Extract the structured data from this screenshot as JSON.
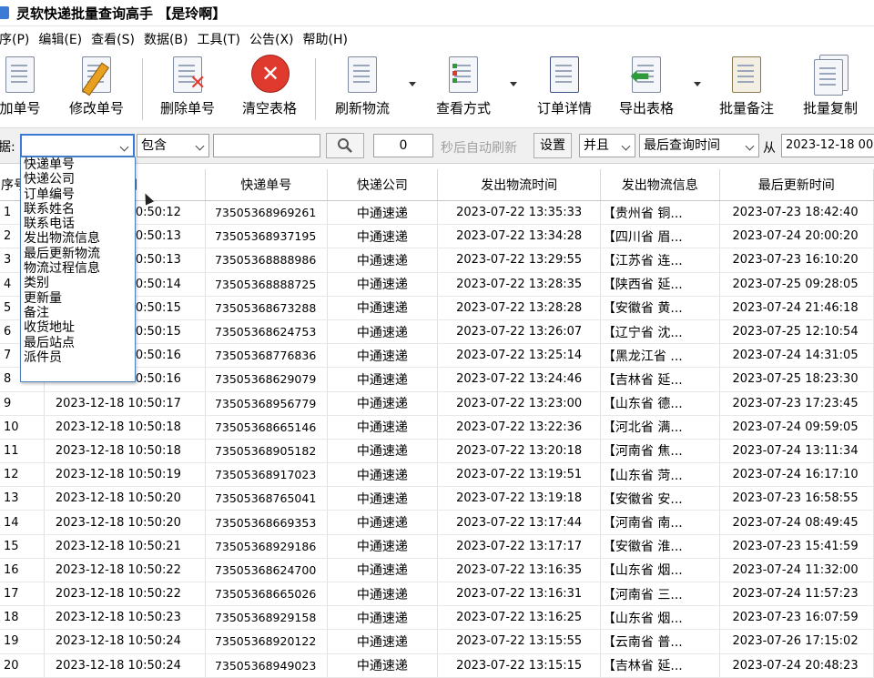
{
  "window": {
    "title": "灵软快递批量查询高手 【是玲啊】"
  },
  "menu": [
    "序(P)",
    "编辑(E)",
    "查看(S)",
    "数据(B)",
    "工具(T)",
    "公告(X)",
    "帮助(H)"
  ],
  "toolbar": {
    "add": "加单号",
    "edit": "修改单号",
    "delete": "删除单号",
    "clear": "清空表格",
    "refresh": "刷新物流",
    "view_mode": "查看方式",
    "order_detail": "订单详情",
    "export": "导出表格",
    "batch_note": "批量备注",
    "batch_copy": "批量复制"
  },
  "filter": {
    "label": "据:",
    "field_value": "",
    "operator": "包含",
    "keyword": "",
    "seconds": "0",
    "auto_refresh_text": "秒后自动刷新",
    "settings_button": "设置",
    "logic": "并且",
    "date_field": "最后查询时间",
    "from_label": "从",
    "from_date": "2023-12-18 00"
  },
  "dropdown_options": [
    "快递单号",
    "快递公司",
    "订单编号",
    "联系姓名",
    "联系电话",
    "发出物流信息",
    "最后更新物流",
    "物流过程信息",
    "类别",
    "更新量",
    "备注",
    "收货地址",
    "最后站点",
    "派件员"
  ],
  "table": {
    "columns": [
      "序号",
      "时间",
      "快递单号",
      "快递公司",
      "发出物流时间",
      "发出物流信息",
      "最后更新时间"
    ],
    "rows": [
      [
        "1",
        "2023-12-18 10:50:12",
        "73505368969261",
        "中通速递",
        "2023-07-22 13:35:33",
        "【贵州省 铜...",
        "2023-07-23 18:42:40"
      ],
      [
        "2",
        "2023-12-18 10:50:13",
        "73505368937195",
        "中通速递",
        "2023-07-22 13:34:28",
        "【四川省 眉...",
        "2023-07-24 20:00:20"
      ],
      [
        "3",
        "2023-12-18 10:50:13",
        "73505368888986",
        "中通速递",
        "2023-07-22 13:29:55",
        "【江苏省 连...",
        "2023-07-23 16:10:20"
      ],
      [
        "4",
        "2023-12-18 10:50:14",
        "73505368888725",
        "中通速递",
        "2023-07-22 13:28:35",
        "【陕西省 延...",
        "2023-07-25 09:28:05"
      ],
      [
        "5",
        "2023-12-18 10:50:15",
        "73505368673288",
        "中通速递",
        "2023-07-22 13:28:28",
        "【安徽省 黄...",
        "2023-07-24 21:46:18"
      ],
      [
        "6",
        "2023-12-18 10:50:15",
        "73505368624753",
        "中通速递",
        "2023-07-22 13:26:07",
        "【辽宁省 沈...",
        "2023-07-25 12:10:54"
      ],
      [
        "7",
        "2023-12-18 10:50:16",
        "73505368776836",
        "中通速递",
        "2023-07-22 13:25:14",
        "【黑龙江省 ...",
        "2023-07-24 14:31:05"
      ],
      [
        "8",
        "2023-12-18 10:50:16",
        "73505368629079",
        "中通速递",
        "2023-07-22 13:24:46",
        "【吉林省 延...",
        "2023-07-25 18:23:30"
      ],
      [
        "9",
        "2023-12-18 10:50:17",
        "73505368956779",
        "中通速递",
        "2023-07-22 13:23:00",
        "【山东省 德...",
        "2023-07-23 17:23:45"
      ],
      [
        "10",
        "2023-12-18 10:50:18",
        "73505368665146",
        "中通速递",
        "2023-07-22 13:22:36",
        "【河北省 满...",
        "2023-07-24 09:59:05"
      ],
      [
        "11",
        "2023-12-18 10:50:18",
        "73505368905182",
        "中通速递",
        "2023-07-22 13:20:18",
        "【河南省 焦...",
        "2023-07-24 13:11:34"
      ],
      [
        "12",
        "2023-12-18 10:50:19",
        "73505368917023",
        "中通速递",
        "2023-07-22 13:19:51",
        "【山东省 菏...",
        "2023-07-24 16:17:10"
      ],
      [
        "13",
        "2023-12-18 10:50:20",
        "73505368765041",
        "中通速递",
        "2023-07-22 13:19:18",
        "【安徽省 安...",
        "2023-07-23 16:58:55"
      ],
      [
        "14",
        "2023-12-18 10:50:20",
        "73505368669353",
        "中通速递",
        "2023-07-22 13:17:44",
        "【河南省 南...",
        "2023-07-24 08:49:45"
      ],
      [
        "15",
        "2023-12-18 10:50:21",
        "73505368929186",
        "中通速递",
        "2023-07-22 13:17:17",
        "【安徽省 淮...",
        "2023-07-23 15:41:59"
      ],
      [
        "16",
        "2023-12-18 10:50:22",
        "73505368624700",
        "中通速递",
        "2023-07-22 13:16:35",
        "【山东省 烟...",
        "2023-07-24 11:32:00"
      ],
      [
        "17",
        "2023-12-18 10:50:22",
        "73505368665026",
        "中通速递",
        "2023-07-22 13:16:31",
        "【河南省 三...",
        "2023-07-24 11:57:23"
      ],
      [
        "18",
        "2023-12-18 10:50:23",
        "73505368929158",
        "中通速递",
        "2023-07-22 13:16:25",
        "【山东省 烟...",
        "2023-07-23 16:07:59"
      ],
      [
        "19",
        "2023-12-18 10:50:24",
        "73505368920122",
        "中通速递",
        "2023-07-22 13:15:55",
        "【云南省 普...",
        "2023-07-26 17:15:02"
      ],
      [
        "20",
        "2023-12-18 10:50:24",
        "73505368949023",
        "中通速递",
        "2023-07-22 13:15:15",
        "【吉林省 延...",
        "2023-07-24 20:48:23"
      ]
    ]
  },
  "icons": {
    "add": "add-document-icon",
    "edit": "edit-pencil-icon",
    "delete": "delete-document-icon",
    "clear": "clear-red-x-icon",
    "refresh": "refresh-document-icon",
    "view_mode": "checklist-icon",
    "order_detail": "order-detail-icon",
    "export": "export-arrow-icon",
    "batch_note": "scroll-note-icon",
    "batch_copy": "copy-documents-icon",
    "search": "magnifier-icon"
  },
  "colors": {
    "accent": "#3b7bd6",
    "clear_red": "#e03a2f",
    "export_green": "#2f9a3a"
  }
}
